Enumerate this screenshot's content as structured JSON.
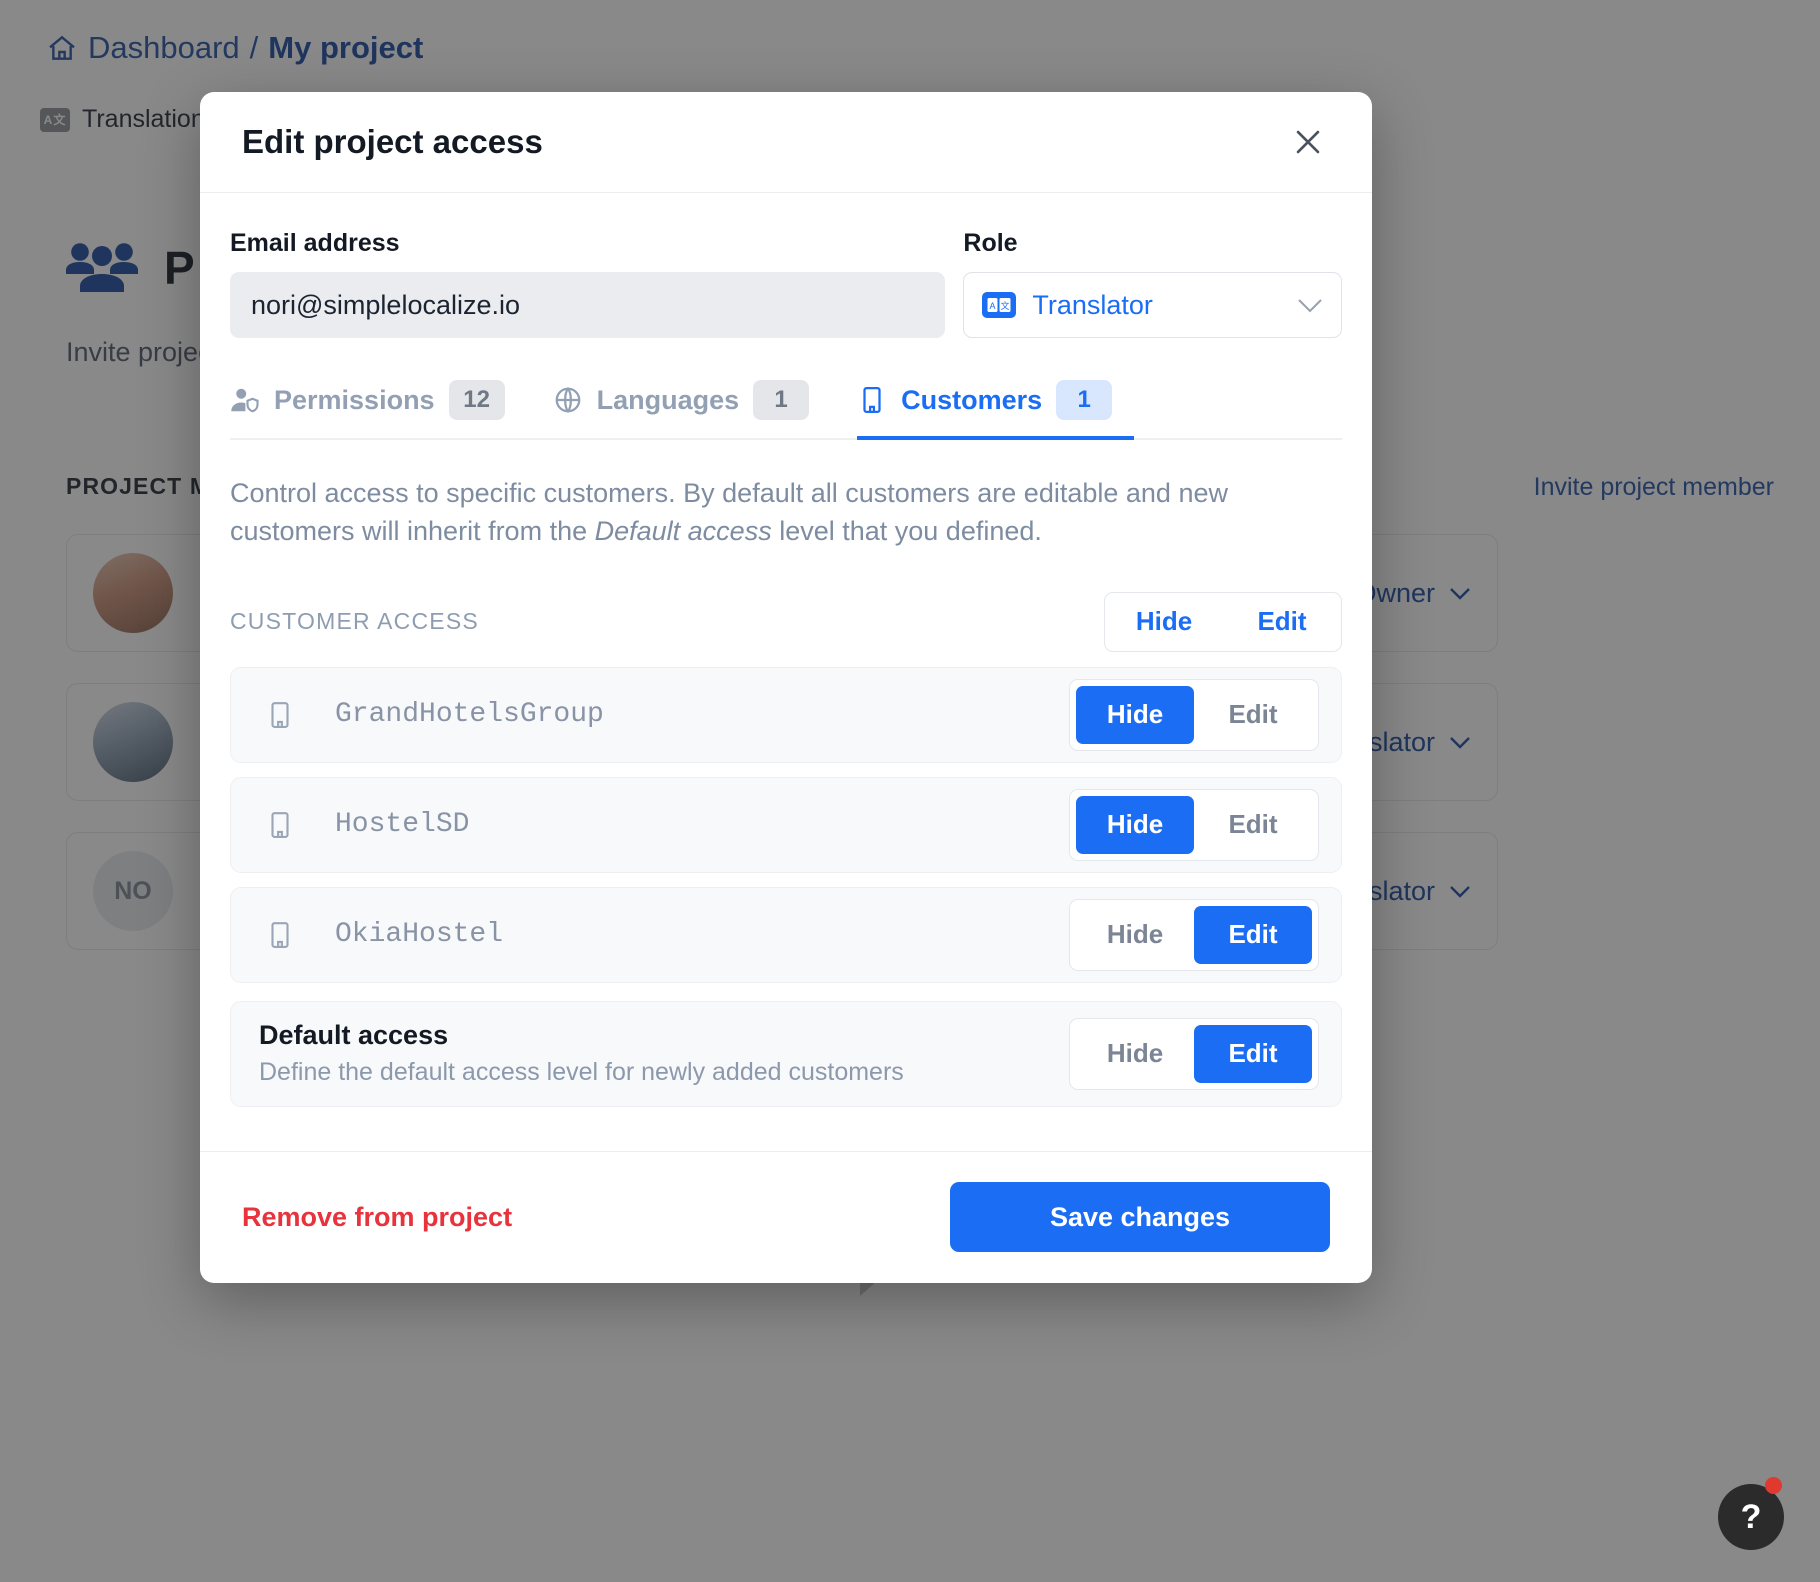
{
  "background": {
    "breadcrumb": {
      "home_icon": "home-icon",
      "dashboard": "Dashboard",
      "separator": "/",
      "current": "My project"
    },
    "subnav": {
      "icon": "translation-icon",
      "label": "Translations"
    },
    "section": {
      "icon": "people-group-icon",
      "title": "P",
      "description": "Invite project members to invite organization",
      "list_header": "PROJECT MEMBERS",
      "invite_label": "Invite project member"
    },
    "members": [
      {
        "avatar": "photo",
        "initials": "",
        "role": "Owner"
      },
      {
        "avatar": "photo",
        "initials": "",
        "role": "Translator"
      },
      {
        "avatar": "initials",
        "initials": "NO",
        "role": "Translator"
      }
    ],
    "help_button": {
      "label": "?",
      "has_notification": true
    }
  },
  "modal": {
    "title": "Edit project access",
    "close_icon": "close-icon",
    "email_field": {
      "label": "Email address",
      "value": "nori@simplelocalize.io",
      "placeholder": "Email address"
    },
    "role_field": {
      "label": "Role",
      "icon": "translate-icon",
      "value": "Translator",
      "chevron": "chevron-down-icon"
    },
    "tabs": [
      {
        "id": "permissions",
        "icon": "user-shield-icon",
        "label": "Permissions",
        "count": "12",
        "active": false
      },
      {
        "id": "languages",
        "icon": "globe-icon",
        "label": "Languages",
        "count": "1",
        "active": false
      },
      {
        "id": "customers",
        "icon": "building-icon",
        "label": "Customers",
        "count": "1",
        "active": true
      }
    ],
    "panel": {
      "description_part1": "Control access to specific customers. By default all customers are editable and new customers will inherit from the ",
      "description_em": "Default access",
      "description_part2": " level that you defined.",
      "access_header": "CUSTOMER ACCESS",
      "bulk_hide": "Hide",
      "bulk_edit": "Edit",
      "customers": [
        {
          "icon": "building-icon",
          "name": "GrandHotelsGroup",
          "hide_label": "Hide",
          "edit_label": "Edit",
          "selected": "hide"
        },
        {
          "icon": "building-icon",
          "name": "HostelSD",
          "hide_label": "Hide",
          "edit_label": "Edit",
          "selected": "hide"
        },
        {
          "icon": "building-icon",
          "name": "OkiaHostel",
          "hide_label": "Hide",
          "edit_label": "Edit",
          "selected": "edit"
        }
      ],
      "default_access": {
        "title": "Default access",
        "subtitle": "Define the default access level for newly added customers",
        "hide_label": "Hide",
        "edit_label": "Edit",
        "selected": "edit"
      }
    },
    "footer": {
      "remove_label": "Remove from project",
      "save_label": "Save changes"
    }
  },
  "colors": {
    "accent_blue": "#1b6ef3",
    "brand_navy": "#1545a0",
    "danger_red": "#e8323c",
    "muted_text": "#8c99ac",
    "panel_bg": "#f8f9fb"
  }
}
